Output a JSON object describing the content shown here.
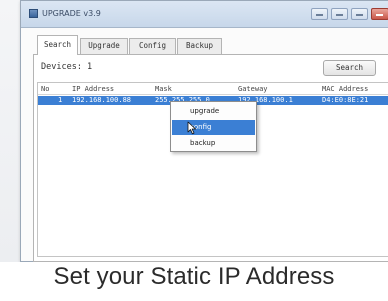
{
  "window": {
    "title": "UPGRADE v3.9"
  },
  "tabs": [
    {
      "label": "Search",
      "active": true
    },
    {
      "label": "Upgrade",
      "active": false
    },
    {
      "label": "Config",
      "active": false
    },
    {
      "label": "Backup",
      "active": false
    }
  ],
  "devices": {
    "label": "Devices: 1",
    "search_button": "Search"
  },
  "table": {
    "columns": [
      "No",
      "IP Address",
      "Mask",
      "Gateway",
      "MAC Address"
    ],
    "rows": [
      {
        "no": "1",
        "ip": "192.168.100.88",
        "mask": "255.255.255.0",
        "gateway": "192.168.100.1",
        "mac": "D4:E0:8E:21"
      }
    ],
    "selected_row_color": "#3b7fd4"
  },
  "context_menu": {
    "items": [
      {
        "label": "upgrade",
        "highlighted": false
      },
      {
        "label": "config",
        "highlighted": true
      },
      {
        "label": "backup",
        "highlighted": false
      }
    ]
  },
  "caption": "Set your Static IP Address",
  "icons": {
    "app": "app-icon",
    "cursor": "mouse-pointer-icon"
  }
}
